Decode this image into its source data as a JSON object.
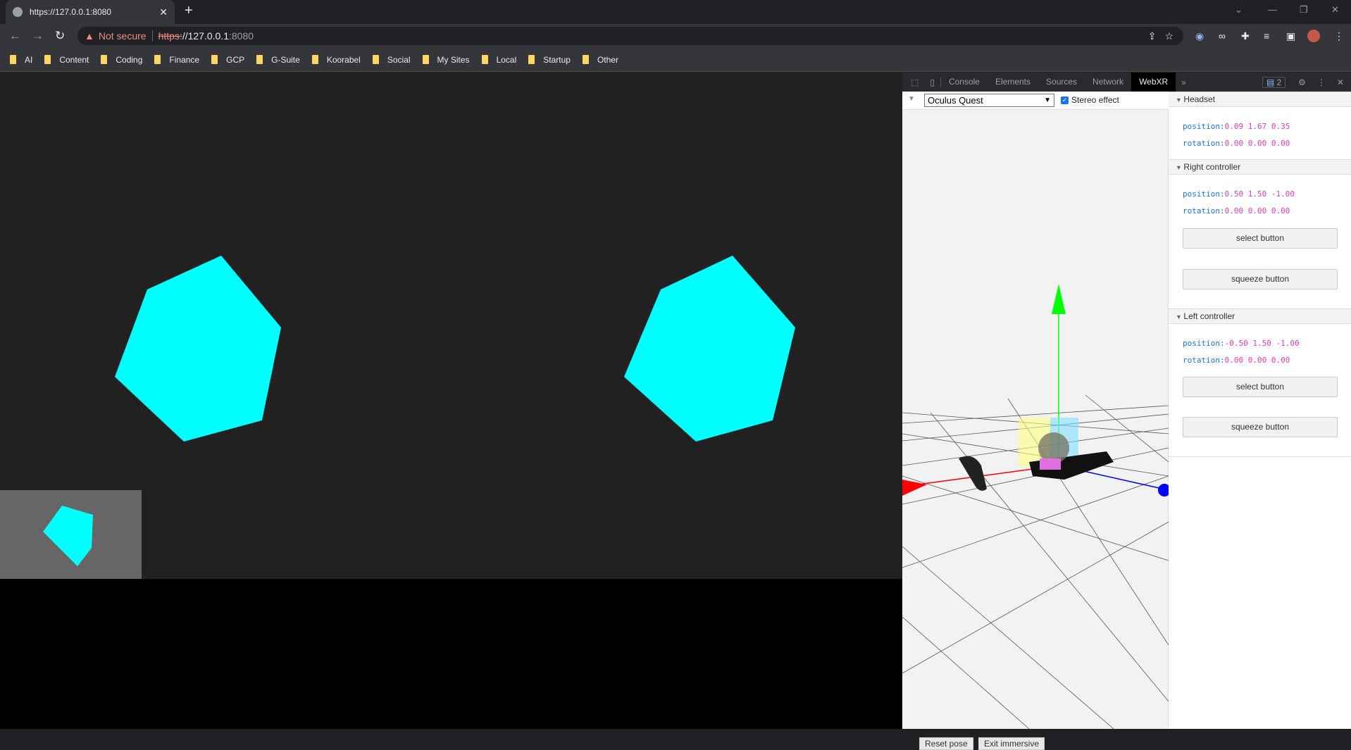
{
  "browser": {
    "tab_title": "https://127.0.0.1:8080",
    "url": {
      "warning": "Not secure",
      "scheme": "https:",
      "host": "//127.0.0.1",
      "port": ":8080"
    },
    "bookmarks": [
      "AI",
      "Content",
      "Coding",
      "Finance",
      "GCP",
      "G-Suite",
      "Koorabel",
      "Social",
      "My Sites",
      "Local",
      "Startup",
      "Other"
    ]
  },
  "scene": {
    "object_color": "#00ffff",
    "background": "#212121"
  },
  "devtools": {
    "tabs": [
      "Console",
      "Elements",
      "Sources",
      "Network",
      "WebXR"
    ],
    "active_tab": "WebXR",
    "issues_count": "2",
    "device": "Oculus Quest",
    "stereo_label": "Stereo effect",
    "stereo_checked": true,
    "reset_pose": "Reset pose",
    "exit_immersive": "Exit immersive",
    "headset": {
      "title": "Headset",
      "position_label": "position:",
      "position": "0.09 1.67 0.35",
      "rotation_label": "rotation:",
      "rotation": "0.00 0.00 0.00"
    },
    "right": {
      "title": "Right controller",
      "position_label": "position:",
      "position": "0.50 1.50 -1.00",
      "rotation_label": "rotation:",
      "rotation": "0.00 0.00 0.00",
      "select": "select button",
      "squeeze": "squeeze button"
    },
    "left": {
      "title": "Left controller",
      "position_label": "position:",
      "position": "-0.50 1.50 -1.00",
      "rotation_label": "rotation:",
      "rotation": "0.00 0.00 0.00",
      "select": "select button",
      "squeeze": "squeeze button"
    }
  }
}
